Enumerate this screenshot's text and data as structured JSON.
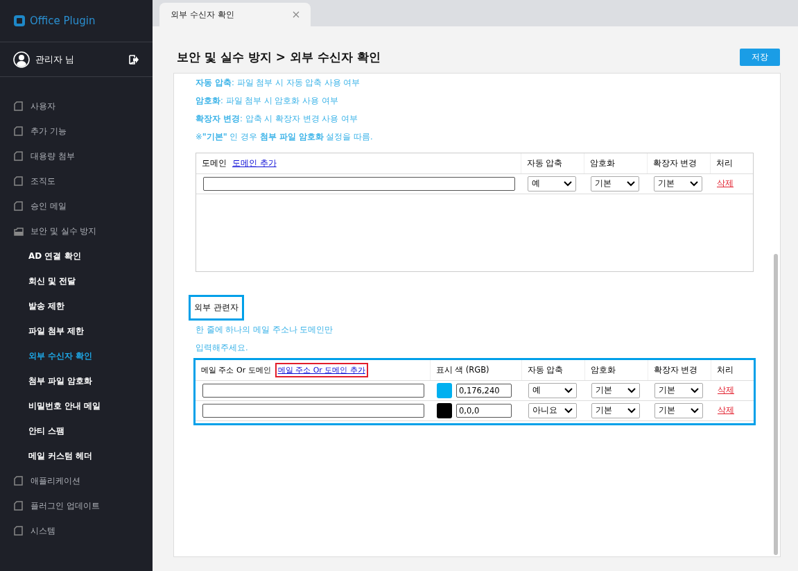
{
  "sidebar": {
    "logo": "Office Plugin",
    "user": "관리자 님",
    "items": [
      {
        "label": "사용자",
        "expanded": false
      },
      {
        "label": "추가 기능",
        "expanded": false
      },
      {
        "label": "대용량 첨부",
        "expanded": false
      },
      {
        "label": "조직도",
        "expanded": false
      },
      {
        "label": "승인 메일",
        "expanded": false
      },
      {
        "label": "보안 및 실수 방지",
        "expanded": true,
        "children": [
          {
            "label": "AD 연결 확인",
            "selected": false
          },
          {
            "label": "회신 및 전달",
            "selected": false
          },
          {
            "label": "발송 제한",
            "selected": false
          },
          {
            "label": "파일 첨부 제한",
            "selected": false
          },
          {
            "label": "외부 수신자 확인",
            "selected": true
          },
          {
            "label": "첨부 파일 암호화",
            "selected": false
          },
          {
            "label": "비밀번호 안내 메일",
            "selected": false
          },
          {
            "label": "안티 스팸",
            "selected": false
          },
          {
            "label": "메일 커스텀 헤더",
            "selected": false
          }
        ]
      },
      {
        "label": "애플리케이션",
        "expanded": false
      },
      {
        "label": "플러그인 업데이트",
        "expanded": false
      },
      {
        "label": "시스템",
        "expanded": false
      }
    ]
  },
  "tabs": [
    {
      "label": "외부 수신자 확인",
      "selected": true
    }
  ],
  "page": {
    "title": "보안 및 실수 방지 > 외부 수신자 확인",
    "save_button": "저장"
  },
  "notes": [
    "**자동 압축**: 파일 첨부 시 자동 압축 사용 여부",
    "**암호화**: 파일 첨부 시 암호화 사용 여부",
    "**확장자 변경**: 압축 시 확장자 변경 사용 여부",
    "※**\"기본\"** 인 경우 **첨부 파일 암호화** 설정을 따름."
  ],
  "domain_table": {
    "header": "도메인",
    "add_link": "도메인 추가",
    "columns": [
      "자동 압축",
      "암호화",
      "확장자 변경",
      "처리"
    ],
    "rows": [
      {
        "value": "",
        "auto_zip": "예",
        "encrypt": "기본",
        "ext_change": "기본",
        "delete": "삭제"
      }
    ]
  },
  "external_section": {
    "label": "외부 관련자",
    "highlighted": true,
    "hint_lines": [
      "한 줄에 하나의 메일 주소나 도메인만",
      "입력해주세요."
    ],
    "table": {
      "highlighted": true,
      "header": "메일 주소 Or 도메인",
      "add_link": "메일 주소 Or 도메인 추가",
      "add_link_highlighted": true,
      "columns": [
        "표시 색 (RGB)",
        "자동 압축",
        "암호화",
        "확장자 변경",
        "처리"
      ],
      "rows": [
        {
          "value": "",
          "color": "#00b0f0",
          "rgb": "0,176,240",
          "auto_zip": "예",
          "encrypt": "기본",
          "ext_change": "기본",
          "delete": "삭제"
        },
        {
          "value": "",
          "color": "#000000",
          "rgb": "0,0,0",
          "auto_zip": "아니요",
          "encrypt": "기본",
          "ext_change": "기본",
          "delete": "삭제"
        }
      ]
    }
  }
}
